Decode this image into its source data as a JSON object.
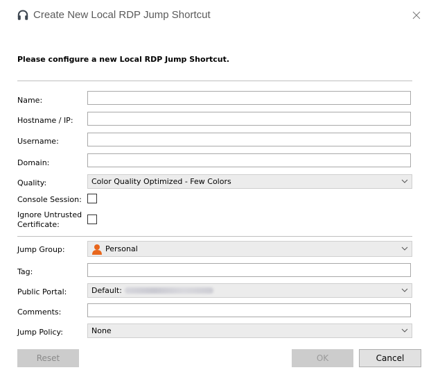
{
  "window": {
    "title": "Create New Local RDP Jump Shortcut",
    "app_icon": "headset-icon",
    "close_icon": "close-icon"
  },
  "heading": "Please configure a new Local RDP Jump Shortcut.",
  "form": {
    "name_label": "Name:",
    "name_value": "",
    "hostname_label": "Hostname / IP:",
    "hostname_value": "",
    "username_label": "Username:",
    "username_value": "",
    "domain_label": "Domain:",
    "domain_value": "",
    "quality_label": "Quality:",
    "quality_value": "Color Quality Optimized - Few Colors",
    "console_label": "Console Session:",
    "console_checked": false,
    "ignore_label_line1": "Ignore Untrusted",
    "ignore_label_line2": "Certificate:",
    "ignore_checked": false,
    "jump_group_label": "Jump Group:",
    "jump_group_value": "Personal",
    "jump_group_icon": "person-icon",
    "tag_label": "Tag:",
    "tag_value": "",
    "portal_label": "Public Portal:",
    "portal_value_prefix": "Default:",
    "comments_label": "Comments:",
    "comments_value": "",
    "jump_policy_label": "Jump Policy:",
    "jump_policy_value": "None"
  },
  "buttons": {
    "reset": "Reset",
    "ok": "OK",
    "cancel": "Cancel"
  },
  "colors": {
    "person_icon": "#e8661c",
    "disabled_text": "#a0a0a0",
    "select_bg": "#ececec"
  }
}
